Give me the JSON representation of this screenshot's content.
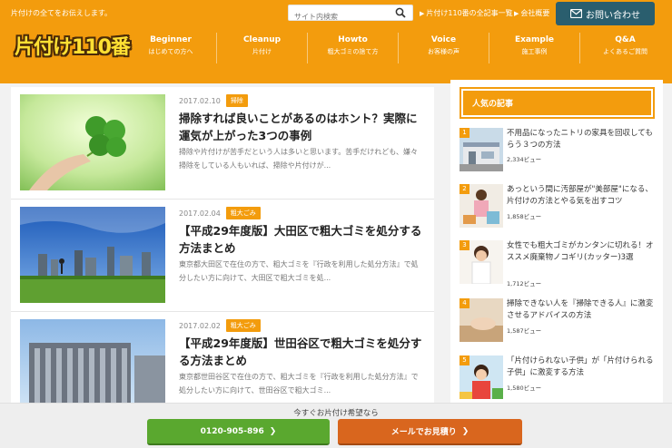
{
  "header": {
    "tagline": "片付けの全てをお伝えします。",
    "search_placeholder": "サイト内検索",
    "links": [
      "片付け110番の全記事一覧",
      "会社概要"
    ],
    "contact_label": "お問い合わせ",
    "logo": "片付け110番",
    "nav": [
      {
        "en": "Beginner",
        "jp": "はじめての方へ"
      },
      {
        "en": "Cleanup",
        "jp": "片付け"
      },
      {
        "en": "Howto",
        "jp": "粗大ゴミの捨て方"
      },
      {
        "en": "Voice",
        "jp": "お客様の声"
      },
      {
        "en": "Example",
        "jp": "施工事例"
      },
      {
        "en": "Q&A",
        "jp": "よくあるご質問"
      }
    ],
    "accent_color": "#f39c0d"
  },
  "articles": [
    {
      "date": "2017.02.10",
      "category": "掃除",
      "title": "掃除すれば良いことがあるのはホント？実際に運気が上がった3つの事例",
      "excerpt": "掃除や片付けが苦手だという人は多いと思います。苦手だけれども、嫌々掃除をしている人もいれば、掃除や片付けが..."
    },
    {
      "date": "2017.02.04",
      "category": "粗大ごみ",
      "title": "【平成29年度版】大田区で粗大ゴミを処分する方法まとめ",
      "excerpt": "東京都大田区で在住の方で、粗大ゴミを『行政を利用した処分方法』で処分したい方に向けて、大田区で粗大ゴミを処..."
    },
    {
      "date": "2017.02.02",
      "category": "粗大ごみ",
      "title": "【平成29年度版】世田谷区で粗大ゴミを処分する方法まとめ",
      "excerpt": "東京都世田谷区で在住の方で、粗大ゴミを『行政を利用した処分方法』で処分したい方に向けて、世田谷区で粗大ゴミ..."
    }
  ],
  "sidebar": {
    "heading": "人気の記事",
    "ranking": [
      {
        "num": "1",
        "title": "不用品になったニトリの家具を回収してもらう３つの方法",
        "views": "2,334ビュー"
      },
      {
        "num": "2",
        "title": "あっという間に汚部屋が\"美部屋\"になる、片付けの方法とやる気を出すコツ",
        "views": "1,858ビュー"
      },
      {
        "num": "3",
        "title": "女性でも粗大ゴミがカンタンに切れる！オススメ廃棄物ノコギリ(カッター)3選",
        "views": "1,712ビュー"
      },
      {
        "num": "4",
        "title": "掃除できない人を『掃除できる人』に激変させるアドバイスの方法",
        "views": "1,587ビュー"
      },
      {
        "num": "5",
        "title": "「片付けられない子供」が「片付けられる子供」に激変する方法",
        "views": "1,580ビュー"
      }
    ]
  },
  "footer": {
    "prompt": "今すぐお片付け希望なら",
    "tel_label": "0120-905-896",
    "mail_label": "メールでお見積り"
  }
}
